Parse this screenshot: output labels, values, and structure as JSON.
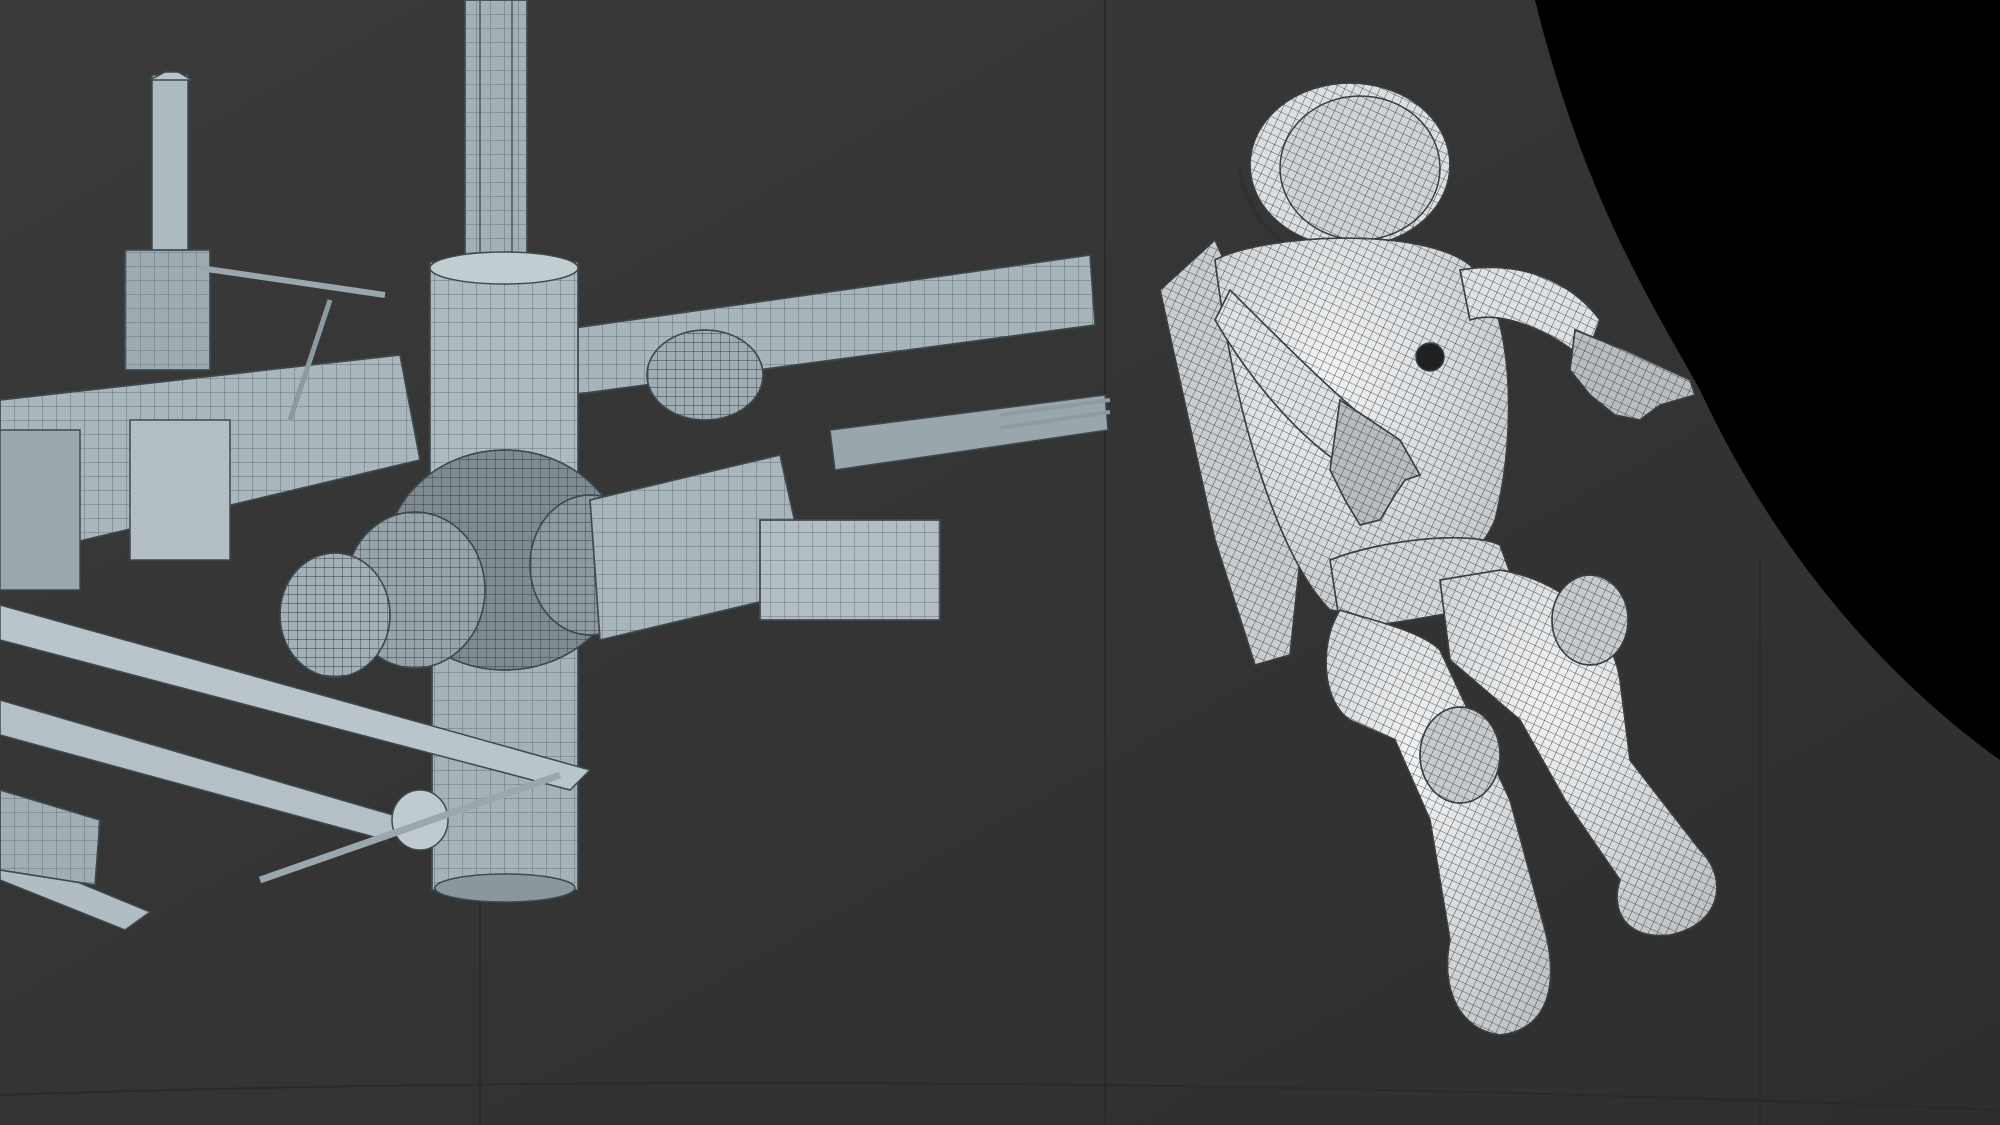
{
  "scene": {
    "colors": {
      "studio_backdrop": "#363636",
      "void": "#000000",
      "station_surface": "#a9b6bc",
      "station_shadow": "#5f6a70",
      "suit_surface": "#e6e8ea",
      "wireframe": "#26292b"
    },
    "subjects": [
      "space-station-model",
      "astronaut-model"
    ],
    "render_style": "clay render with wireframe overlay"
  }
}
